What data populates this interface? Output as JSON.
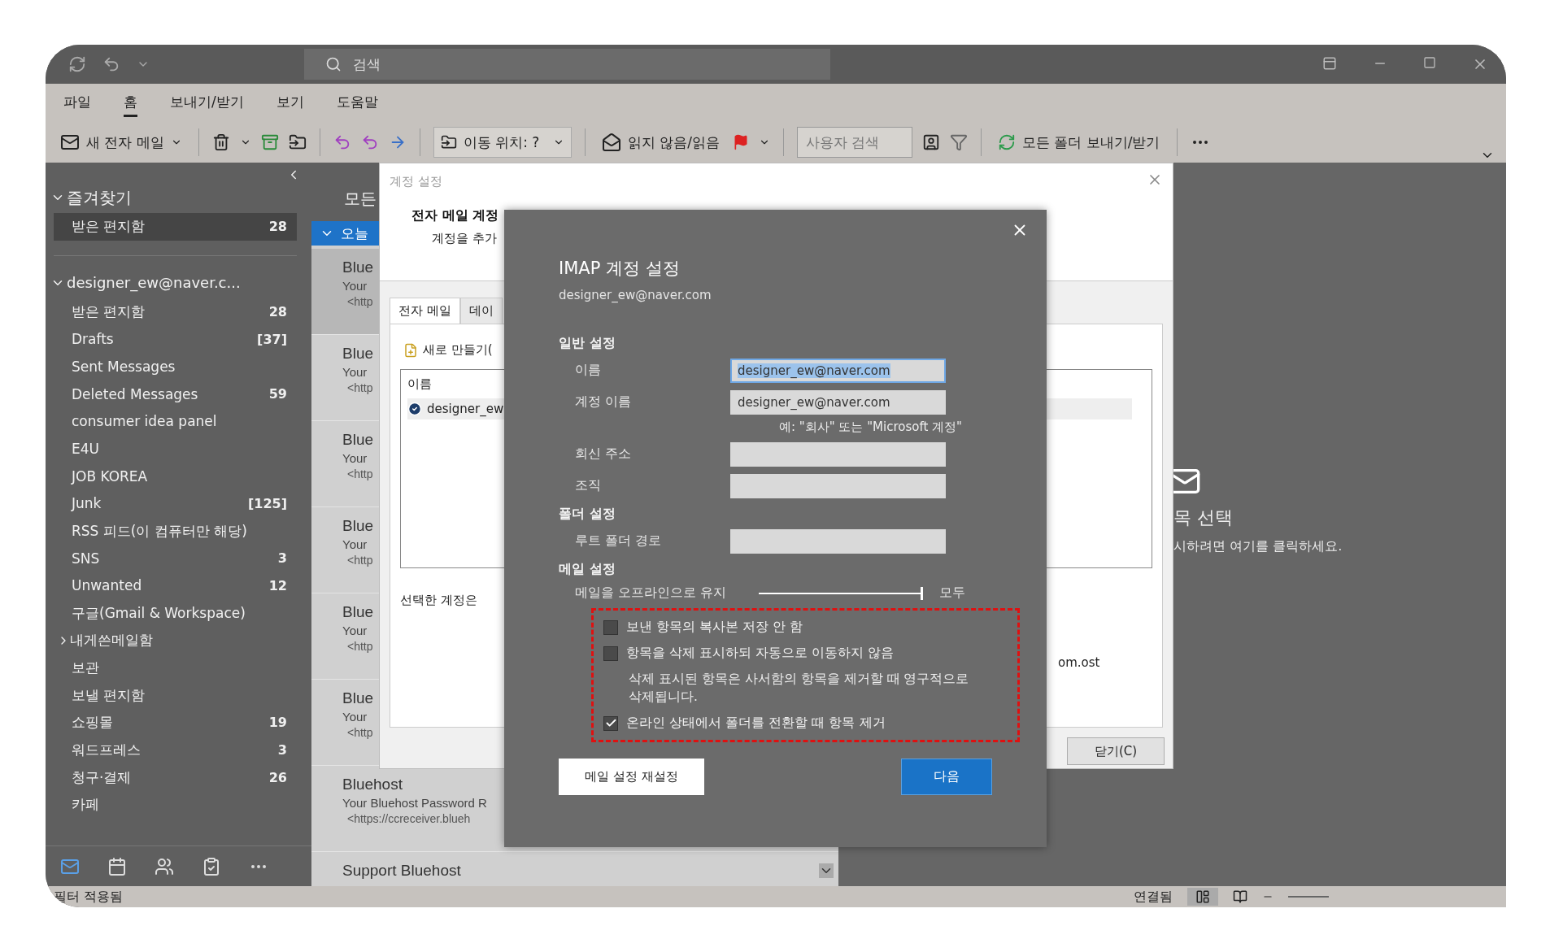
{
  "title_bar": {
    "search": {
      "placeholder": "검색"
    }
  },
  "menu": [
    {
      "label": "파일",
      "selected": false
    },
    {
      "label": "홈",
      "selected": true
    },
    {
      "label": "보내기/받기",
      "selected": false
    },
    {
      "label": "보기",
      "selected": false
    },
    {
      "label": "도움말",
      "selected": false
    }
  ],
  "toolbar": {
    "new_mail": "새 전자 메일",
    "move_to": "이동 위치: ?",
    "read_unread": "읽지 않음/읽음",
    "people_search": {
      "placeholder": "사용자 검색"
    },
    "send_receive": "모든 폴더 보내기/받기"
  },
  "sidebar": {
    "groups": [
      {
        "label": "즐겨찾기",
        "expanded": true,
        "children": [
          {
            "label": "받은 편지함",
            "count": "28",
            "selected": true
          }
        ]
      },
      {
        "label": "designer_ew@naver.c...",
        "expanded": true,
        "children": [
          {
            "label": "받은 편지함",
            "count": "28",
            "selected": false
          },
          {
            "label": "Drafts",
            "count": "[37]",
            "selected": false
          },
          {
            "label": "Sent Messages",
            "selected": false
          },
          {
            "label": "Deleted Messages",
            "count": "59",
            "selected": false
          },
          {
            "label": "consumer idea panel",
            "selected": false
          },
          {
            "label": "E4U",
            "selected": false
          },
          {
            "label": "JOB KOREA",
            "selected": false
          },
          {
            "label": "Junk",
            "count": "[125]",
            "selected": false
          },
          {
            "label": "RSS 피드(이 컴퓨터만 해당)",
            "selected": false
          },
          {
            "label": "SNS",
            "count": "3",
            "selected": false
          },
          {
            "label": "Unwanted",
            "count": "12",
            "selected": false
          },
          {
            "label": "구글(Gmail & Workspace)",
            "selected": false
          },
          {
            "label": "내게쓴메일함",
            "selected": false,
            "expanded": false
          },
          {
            "label": "보관",
            "selected": false
          },
          {
            "label": "보낼 편지함",
            "selected": false
          },
          {
            "label": "쇼핑몰",
            "count": "19",
            "selected": false
          },
          {
            "label": "워드프레스",
            "count": "3",
            "selected": false
          },
          {
            "label": "청구·결제",
            "count": "26",
            "selected": false
          },
          {
            "label": "카페",
            "selected": false
          }
        ]
      }
    ]
  },
  "mail_list": {
    "tab": "모든",
    "group": {
      "label": "오늘",
      "expanded": true
    },
    "items": [
      {
        "sender": "Blue",
        "subject": "Your",
        "preview": "<http",
        "selected": true
      },
      {
        "sender": "Blue",
        "subject": "Your",
        "preview": "<http",
        "selected": false
      },
      {
        "sender": "Blue",
        "subject": "Your",
        "preview": "<http",
        "selected": false
      },
      {
        "sender": "Blue",
        "subject": "Your",
        "preview": "<http",
        "selected": false
      },
      {
        "sender": "Blue",
        "subject": "Your",
        "preview": "<http",
        "selected": false
      },
      {
        "sender": "Blue",
        "subject": "Your",
        "preview": "<http",
        "selected": false
      },
      {
        "sender": "Bluehost",
        "subject": "Your Bluehost Password R",
        "preview": "<https://ccreceiver.blueh",
        "selected": false
      },
      {
        "sender": "Support Bluehost",
        "selected": false
      }
    ]
  },
  "reading_pane": {
    "title": "목 선택",
    "hint": "시하려면 여기를 클릭하세요."
  },
  "account_dialog": {
    "title": "계정 설정",
    "heading": "전자 메일 계정",
    "subheading": "계정을 추가",
    "tabs": [
      {
        "label": "전자 메일",
        "selected": true
      },
      {
        "label": "데이",
        "selected": false
      }
    ],
    "new_button": "새로 만들기(",
    "list": {
      "column": "이름",
      "rows": [
        {
          "name": "designer_ew",
          "default": true
        }
      ]
    },
    "note": "선택한 계정은",
    "data_file": "om.ost",
    "close_button": "닫기(C)"
  },
  "imap_dialog": {
    "title": "IMAP 계정 설정",
    "email": "designer_ew@naver.com",
    "sections": [
      {
        "heading": "일반 설정",
        "fields": [
          {
            "label": "이름",
            "value": "designer_ew@naver.com",
            "focused": true
          },
          {
            "label": "계정 이름",
            "value": "designer_ew@naver.com",
            "focused": false,
            "hint": "예: \"회사\" 또는 \"Microsoft 계정\""
          },
          {
            "label": "회신 주소",
            "focused": false
          },
          {
            "label": "조직",
            "focused": false
          }
        ]
      },
      {
        "heading": "폴더 설정",
        "fields": [
          {
            "label": "루트 폴더 경로",
            "focused": false
          }
        ]
      },
      {
        "heading": "메일 설정"
      }
    ],
    "offline": {
      "label": "메일을 오프라인으로 유지",
      "level": 1,
      "reading": "모두"
    },
    "options_highlighted": true,
    "options": [
      {
        "kind": "checkbox",
        "label": "보낸 항목의 복사본 저장 안 함",
        "checked": false
      },
      {
        "kind": "checkbox",
        "label": "항목을 삭제 표시하되 자동으로 이동하지 않음",
        "checked": false
      },
      {
        "kind": "note",
        "text": "삭제 표시된 항목은 사서함의 항목을 제거할 때 영구적으로 삭제됩니다."
      },
      {
        "kind": "checkbox",
        "label": "온라인 상태에서 폴더를 전환할 때 항목 제거",
        "checked": true
      }
    ],
    "reset_button": "메일 설정 재설정",
    "next_button": "다음"
  },
  "status_bar": {
    "left": "필터 적용됨",
    "connection": "연결됨"
  }
}
